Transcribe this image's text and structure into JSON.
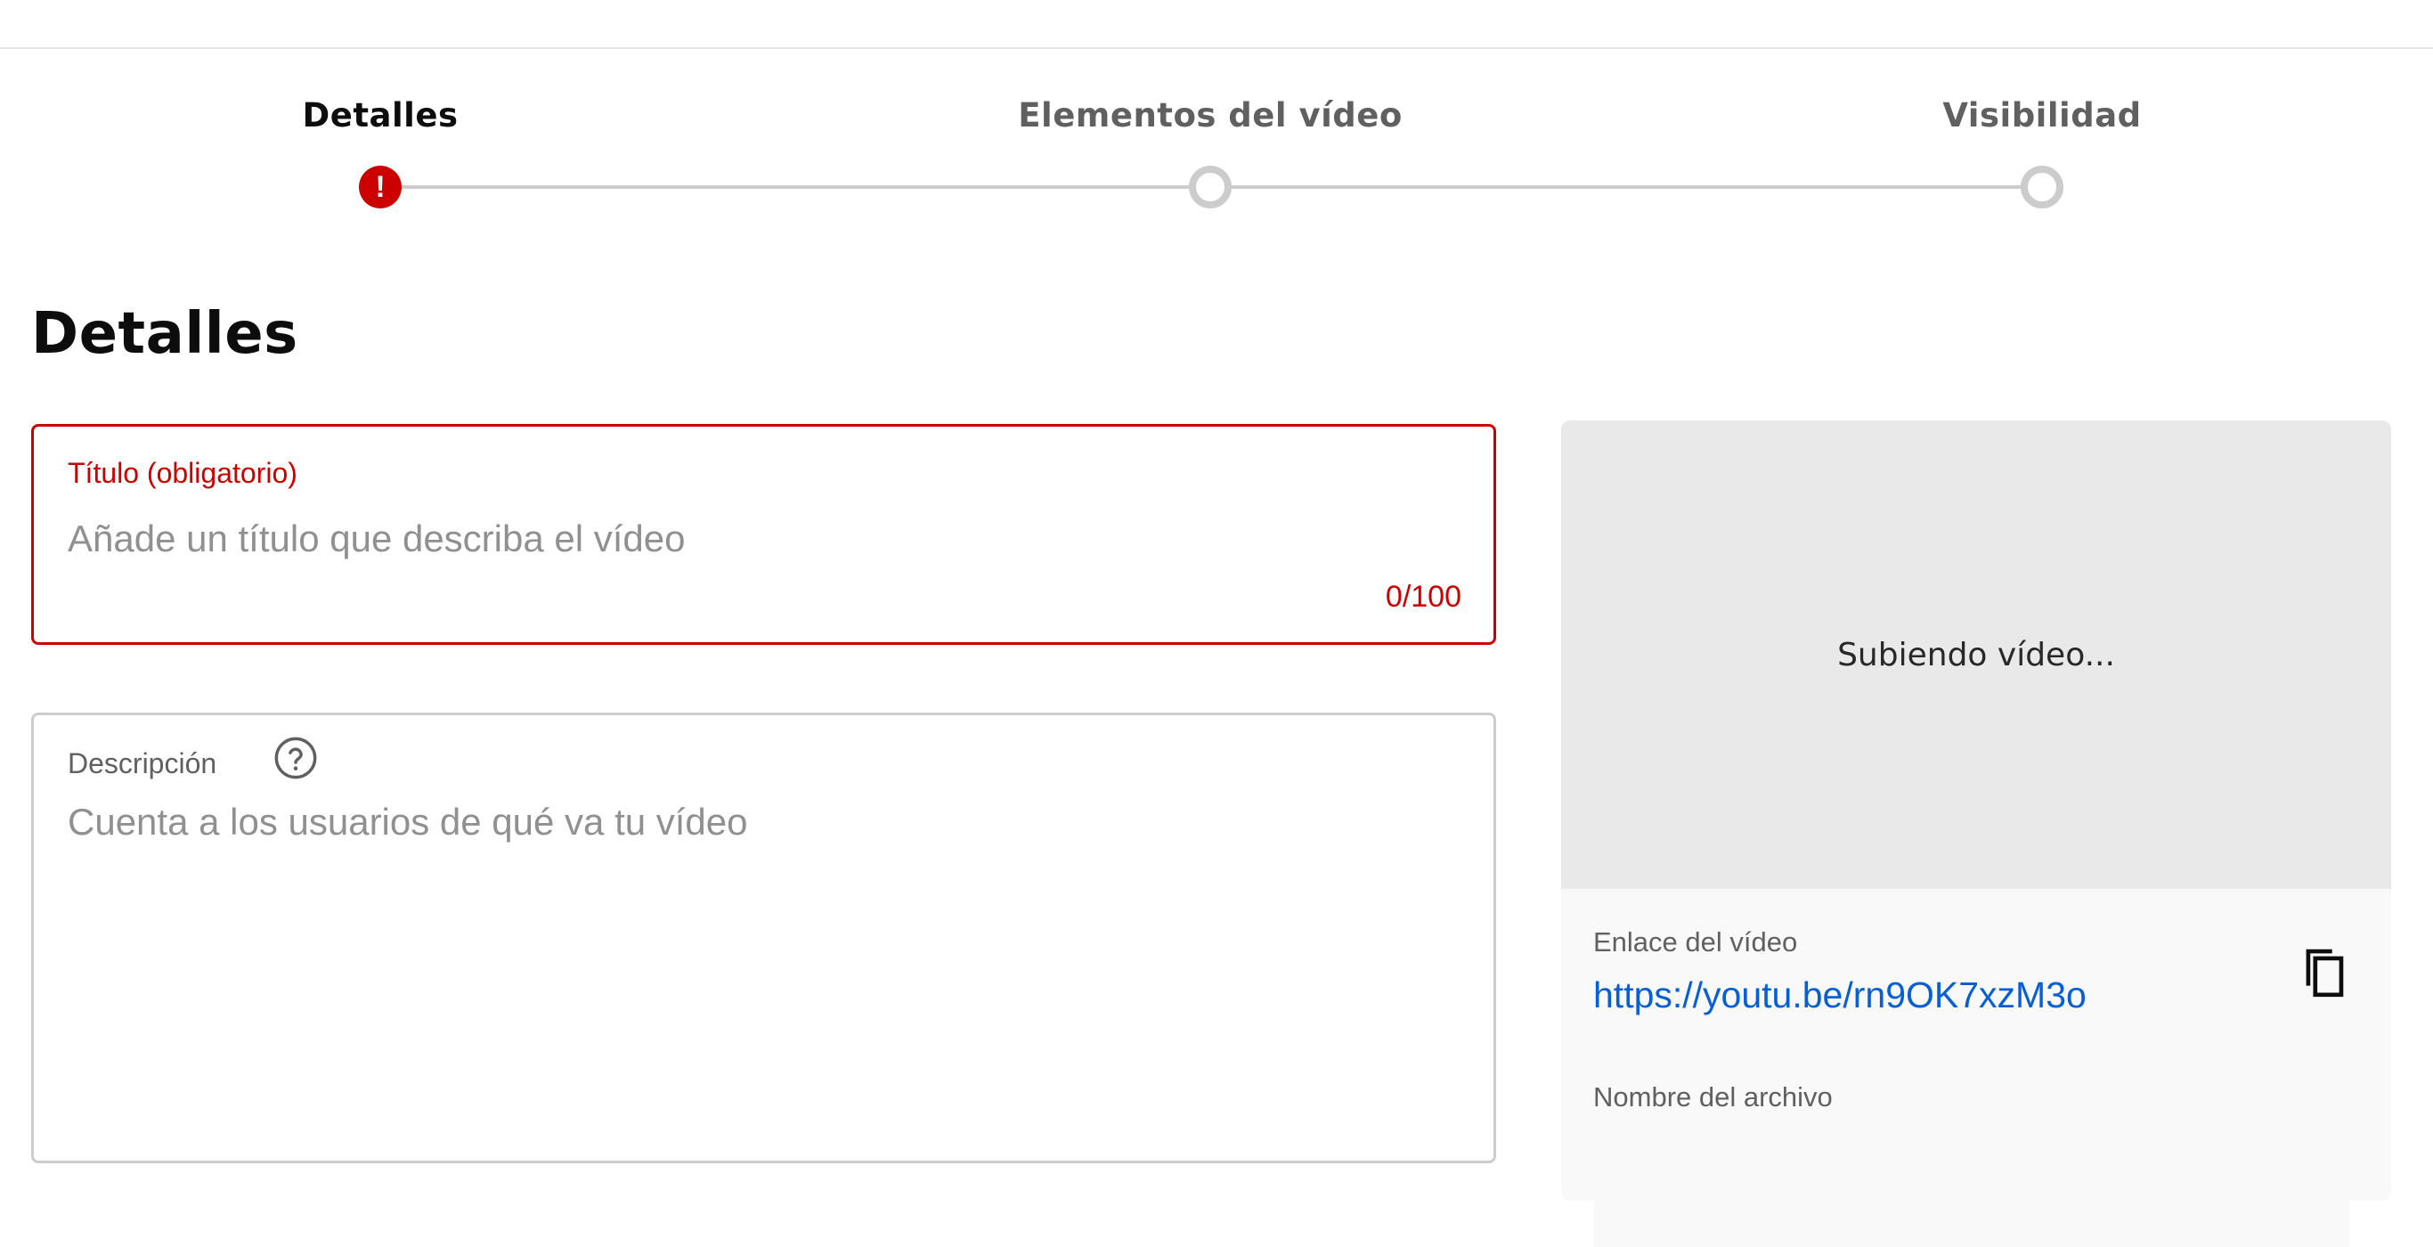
{
  "stepper": {
    "steps": [
      {
        "label": "Detalles",
        "state": "error"
      },
      {
        "label": "Elementos del vídeo",
        "state": "pending"
      },
      {
        "label": "Visibilidad",
        "state": "pending"
      }
    ],
    "error_glyph": "!"
  },
  "details": {
    "heading": "Detalles",
    "title_field": {
      "label": "Título (obligatorio)",
      "placeholder": "Añade un título que describa el vídeo",
      "value": "",
      "counter": "0/100"
    },
    "description_field": {
      "label": "Descripción",
      "placeholder": "Cuenta a los usuarios de qué va tu vídeo",
      "value": "",
      "help_icon": "help-circle-icon"
    }
  },
  "preview": {
    "status": "Subiendo vídeo...",
    "link_label": "Enlace del vídeo",
    "link": "https://youtu.be/rn9OK7xzM3o",
    "copy_icon": "copy-icon",
    "filename_label": "Nombre del archivo"
  },
  "colors": {
    "error": "#cc0000",
    "link": "#065fd4",
    "inactive": "#cccccc",
    "preview_bg": "#e9e9e9",
    "panel_bg": "#f9f9f9"
  }
}
